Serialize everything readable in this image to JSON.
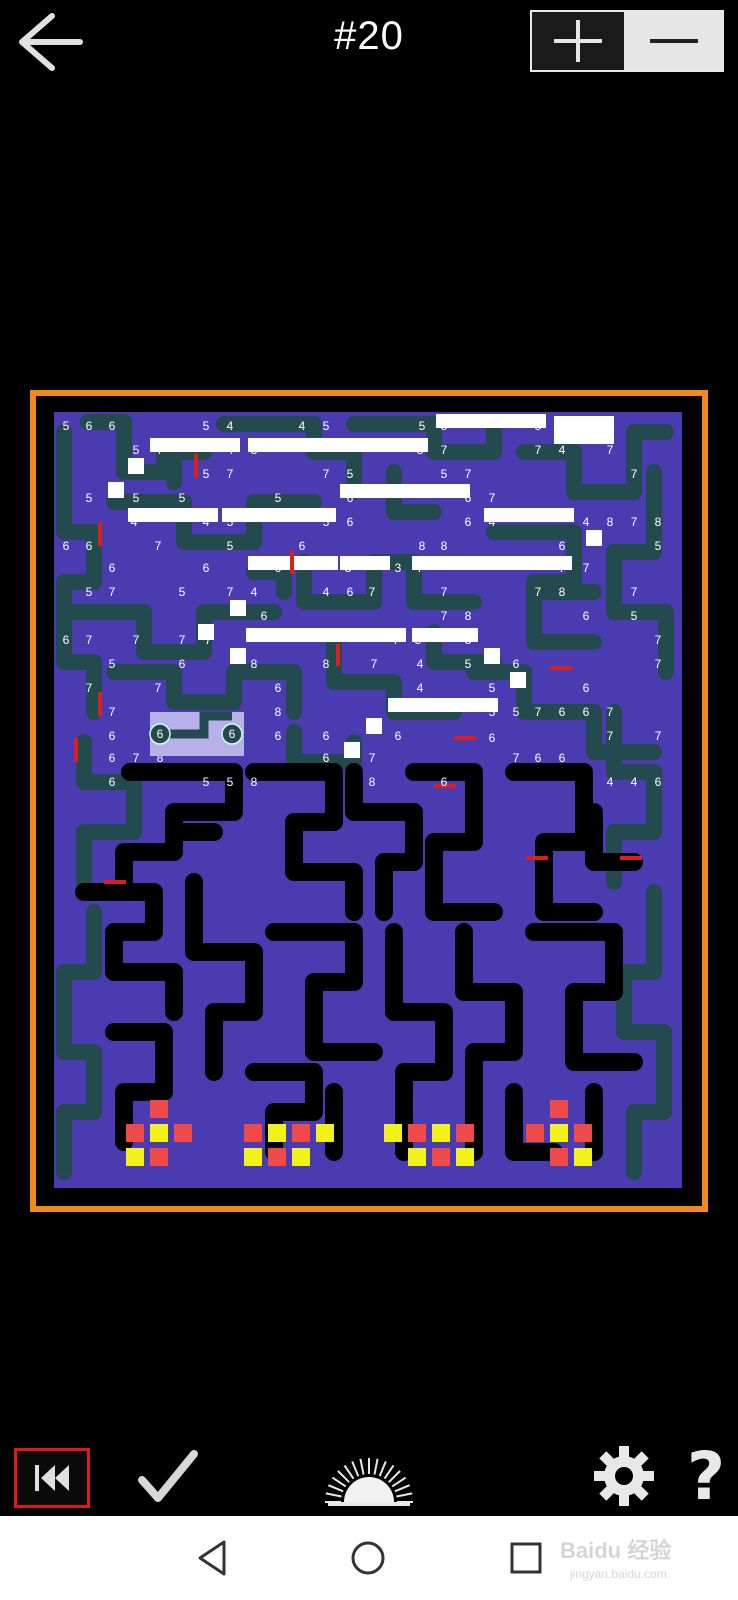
{
  "header": {
    "back_icon": "arrow-left-icon",
    "level_title": "#20",
    "zoom_in_icon": "plus-icon",
    "zoom_out_icon": "minus-icon"
  },
  "colors": {
    "frame": "#f08a1a",
    "board_purple": "#4b3bb0",
    "teal_path": "#234a4e",
    "black_path": "#000000",
    "red_marker": "#d82020",
    "red_tile": "#ef4a4a",
    "yellow_tile": "#f2f21a"
  },
  "board": {
    "cells": [
      {
        "n": "5"
      },
      {
        "n": "6"
      },
      {
        "n": "6"
      },
      {
        "n": "5"
      },
      {
        "n": "4"
      },
      {
        "n": "4"
      },
      {
        "n": "5"
      },
      {
        "n": "5"
      },
      {
        "n": "5"
      },
      {
        "n": "5"
      },
      {
        "n": "4"
      },
      {
        "n": "5"
      },
      {
        "n": "4"
      },
      {
        "n": "4"
      },
      {
        "n": "8"
      },
      {
        "n": "8"
      },
      {
        "n": "7"
      },
      {
        "n": "7"
      },
      {
        "n": "4"
      },
      {
        "n": "7"
      },
      {
        "n": "5"
      },
      {
        "n": "7"
      },
      {
        "n": "7"
      },
      {
        "n": "5"
      },
      {
        "n": "5"
      },
      {
        "n": "7"
      },
      {
        "n": "7"
      },
      {
        "n": "5"
      },
      {
        "n": "5"
      },
      {
        "n": "5"
      },
      {
        "n": "5"
      },
      {
        "n": "6"
      },
      {
        "n": "6"
      },
      {
        "n": "7"
      },
      {
        "n": "4"
      },
      {
        "n": "4"
      },
      {
        "n": "5"
      },
      {
        "n": "5"
      },
      {
        "n": "6"
      },
      {
        "n": "6"
      },
      {
        "n": "4"
      },
      {
        "n": "4"
      },
      {
        "n": "8"
      },
      {
        "n": "7"
      },
      {
        "n": "8"
      },
      {
        "n": "6"
      },
      {
        "n": "6"
      },
      {
        "n": "7"
      },
      {
        "n": "5"
      },
      {
        "n": "6"
      },
      {
        "n": "8"
      },
      {
        "n": "8"
      },
      {
        "n": "6"
      },
      {
        "n": "5"
      },
      {
        "n": "6"
      },
      {
        "n": "6"
      },
      {
        "n": "6"
      },
      {
        "n": "3"
      },
      {
        "n": "3"
      },
      {
        "n": "7"
      },
      {
        "n": "7"
      },
      {
        "n": "7"
      },
      {
        "n": "5"
      },
      {
        "n": "7"
      },
      {
        "n": "5"
      },
      {
        "n": "7"
      },
      {
        "n": "4"
      },
      {
        "n": "4"
      },
      {
        "n": "6"
      },
      {
        "n": "7"
      },
      {
        "n": "7"
      },
      {
        "n": "7"
      },
      {
        "n": "8"
      },
      {
        "n": "7"
      },
      {
        "n": "6"
      },
      {
        "n": "7"
      },
      {
        "n": "8"
      },
      {
        "n": "6"
      },
      {
        "n": "5"
      },
      {
        "n": "6"
      },
      {
        "n": "7"
      },
      {
        "n": "7"
      },
      {
        "n": "7"
      },
      {
        "n": "7"
      },
      {
        "n": "7"
      },
      {
        "n": "3"
      },
      {
        "n": "3"
      },
      {
        "n": "7"
      },
      {
        "n": "5"
      },
      {
        "n": "6"
      },
      {
        "n": "8"
      },
      {
        "n": "8"
      },
      {
        "n": "7"
      },
      {
        "n": "4"
      },
      {
        "n": "5"
      },
      {
        "n": "6"
      },
      {
        "n": "7"
      },
      {
        "n": "7"
      },
      {
        "n": "7"
      },
      {
        "n": "6"
      },
      {
        "n": "4"
      },
      {
        "n": "5"
      },
      {
        "n": "6"
      },
      {
        "n": "7"
      },
      {
        "n": "8"
      },
      {
        "n": "5"
      },
      {
        "n": "5"
      },
      {
        "n": "7"
      },
      {
        "n": "6"
      },
      {
        "n": "6"
      },
      {
        "n": "7"
      },
      {
        "n": "6"
      },
      {
        "n": "6"
      },
      {
        "n": "6"
      },
      {
        "n": "6"
      },
      {
        "n": "7"
      },
      {
        "n": "7"
      },
      {
        "n": "6"
      },
      {
        "n": "6"
      },
      {
        "n": "7"
      },
      {
        "n": "8"
      },
      {
        "n": "6"
      },
      {
        "n": "7"
      },
      {
        "n": "7"
      },
      {
        "n": "6"
      },
      {
        "n": "6"
      },
      {
        "n": "6"
      },
      {
        "n": "5"
      },
      {
        "n": "5"
      },
      {
        "n": "8"
      },
      {
        "n": "8"
      },
      {
        "n": "6"
      },
      {
        "n": "4"
      },
      {
        "n": "4"
      },
      {
        "n": "6"
      }
    ]
  },
  "player": {
    "token_left": "6",
    "token_right": "6"
  },
  "toolbar": {
    "rewind_icon": "rewind-icon",
    "check_icon": "checkmark-icon",
    "sun_icon": "sunrise-icon",
    "settings_icon": "gear-icon",
    "help_label": "?"
  },
  "navbar": {
    "back_icon": "nav-back-icon",
    "home_icon": "nav-home-icon",
    "recent_icon": "nav-recent-icon",
    "watermark": "Baidu 经验",
    "watermark_sub": "jingyan.baidu.com"
  }
}
